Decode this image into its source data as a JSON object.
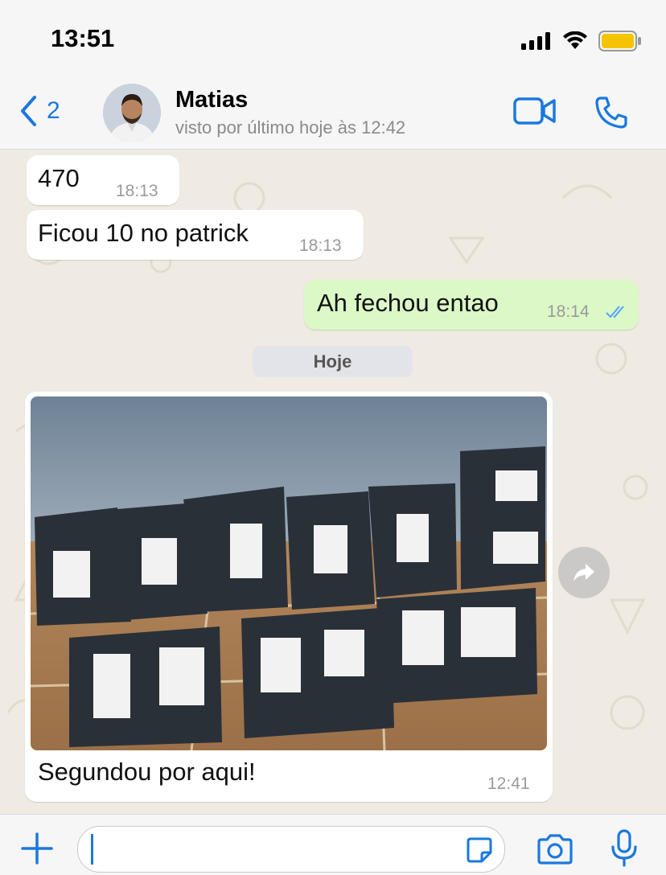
{
  "status_bar": {
    "time": "13:51",
    "icons": [
      "signal-icon",
      "wifi-icon",
      "battery-icon"
    ]
  },
  "header": {
    "back_count": "2",
    "contact_name": "Matias",
    "last_seen": "visto por último hoje às 12:42",
    "icons": [
      "back-chevron-icon",
      "video-call-icon",
      "phone-icon"
    ]
  },
  "messages": [
    {
      "direction": "in",
      "text": "470",
      "time": "18:13"
    },
    {
      "direction": "in",
      "text": "Ficou 10 no patrick",
      "time": "18:13"
    },
    {
      "direction": "out",
      "text": "Ah fechou entao",
      "time": "18:14",
      "status": "read"
    },
    {
      "direction": "in",
      "type": "image",
      "caption": "Segundou por aqui!",
      "time": "12:41",
      "image_subject": "packages-photo"
    }
  ],
  "date_separator": "Hoje",
  "input_bar": {
    "value": "",
    "icons": [
      "plus-icon",
      "sticker-icon",
      "camera-icon",
      "microphone-icon"
    ]
  },
  "colors": {
    "accent": "#1a78e0",
    "outgoing_bubble": "#dbf8c6",
    "incoming_bubble": "#ffffff",
    "chat_bg": "#efeae2",
    "read_ticks": "#53a6fa"
  }
}
